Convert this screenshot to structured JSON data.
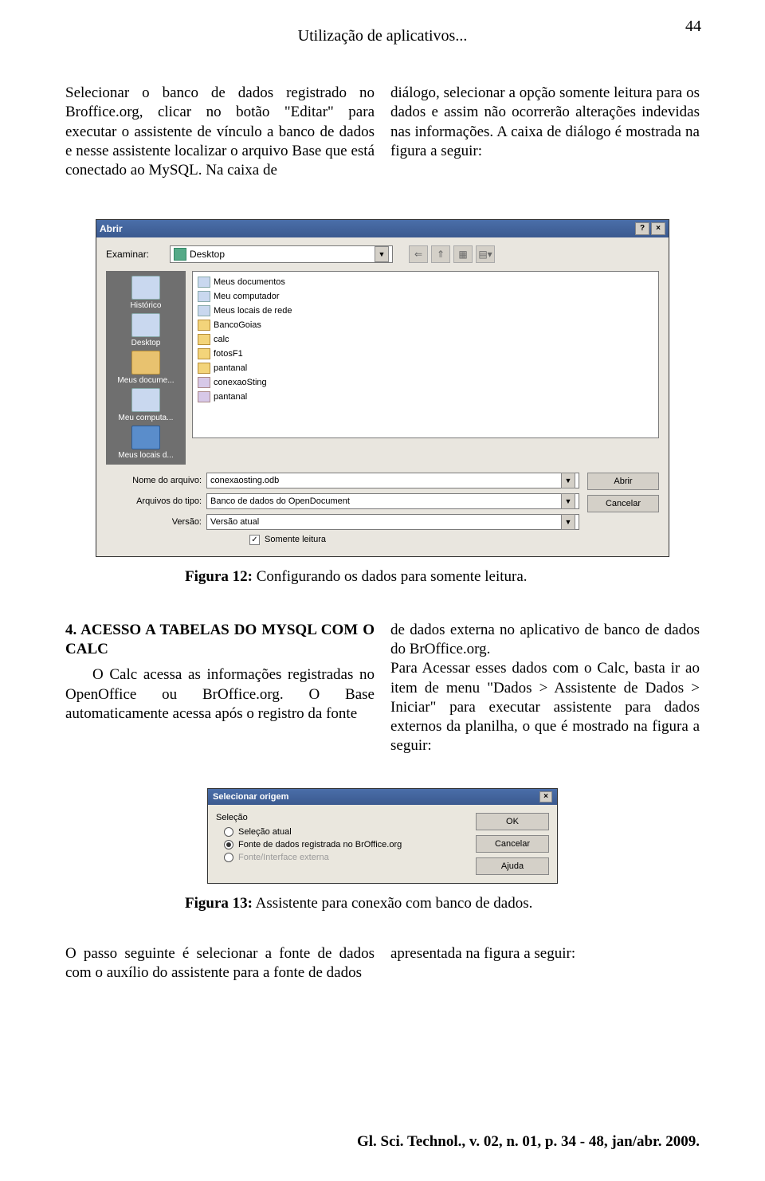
{
  "page_number": "44",
  "header": "Utilização de aplicativos...",
  "para_left_1": "Selecionar o banco de dados registrado no Broffice.org, clicar no botão \"Editar\" para executar o assistente de vínculo a banco de dados e nesse assistente localizar o arquivo Base que está conectado ao MySQL. Na caixa de",
  "para_right_1": "diálogo, selecionar a opção somente leitura para os dados e assim não ocorrerão alterações indevidas nas informações. A caixa de diálogo é mostrada na figura a seguir:",
  "dialog1": {
    "title": "Abrir",
    "examine_label": "Examinar:",
    "examine_value": "Desktop",
    "places": [
      "Histórico",
      "Desktop",
      "Meus docume...",
      "Meu computa...",
      "Meus locais d..."
    ],
    "files": [
      {
        "name": "Meus documentos",
        "cls": "sys"
      },
      {
        "name": "Meu computador",
        "cls": "sys"
      },
      {
        "name": "Meus locais de rede",
        "cls": "sys"
      },
      {
        "name": "BancoGoias",
        "cls": ""
      },
      {
        "name": "calc",
        "cls": ""
      },
      {
        "name": "fotosF1",
        "cls": ""
      },
      {
        "name": "pantanal",
        "cls": ""
      },
      {
        "name": "conexaoSting",
        "cls": "db"
      },
      {
        "name": "pantanal",
        "cls": "db"
      }
    ],
    "filename_label": "Nome do arquivo:",
    "filename_value": "conexaosting.odb",
    "filetype_label": "Arquivos do tipo:",
    "filetype_value": "Banco de dados do OpenDocument",
    "version_label": "Versão:",
    "version_value": "Versão atual",
    "btn_open": "Abrir",
    "btn_cancel": "Cancelar",
    "readonly": "Somente leitura",
    "nav_back": "⇐",
    "nav_up": "⇑",
    "nav_new": "▦",
    "nav_view": "▤▾"
  },
  "caption1_bold": "Figura 12:",
  "caption1_rest": " Configurando os dados para somente leitura.",
  "section2": {
    "heading": "4. ACESSO A TABELAS DO MYSQL COM O CALC",
    "left": "O Calc acessa as informações registradas no OpenOffice ou BrOffice.org. O Base automaticamente acessa após o registro da fonte",
    "right": "de dados externa no aplicativo de banco de dados do BrOffice.org.\n        Para Acessar esses dados com o Calc, basta ir ao item de menu \"Dados > Assistente de Dados > Iniciar\" para executar assistente para dados externos da planilha, o que é mostrado na figura a seguir:"
  },
  "dialog2": {
    "title": "Selecionar origem",
    "group": "Seleção",
    "opt1": "Seleção atual",
    "opt2": "Fonte de dados registrada no BrOffice.org",
    "opt3": "Fonte/Interface externa",
    "btn_ok": "OK",
    "btn_cancel": "Cancelar",
    "btn_help": "Ajuda"
  },
  "caption2_bold": "Figura 13:",
  "caption2_rest": " Assistente para conexão com banco de dados.",
  "para_left_3": "O passo seguinte é selecionar a fonte de dados com o auxílio do assistente para a fonte de dados",
  "para_right_3": "apresentada na figura a seguir:",
  "footer": "Gl. Sci. Technol., v. 02, n. 01, p. 34 - 48, jan/abr. 2009."
}
